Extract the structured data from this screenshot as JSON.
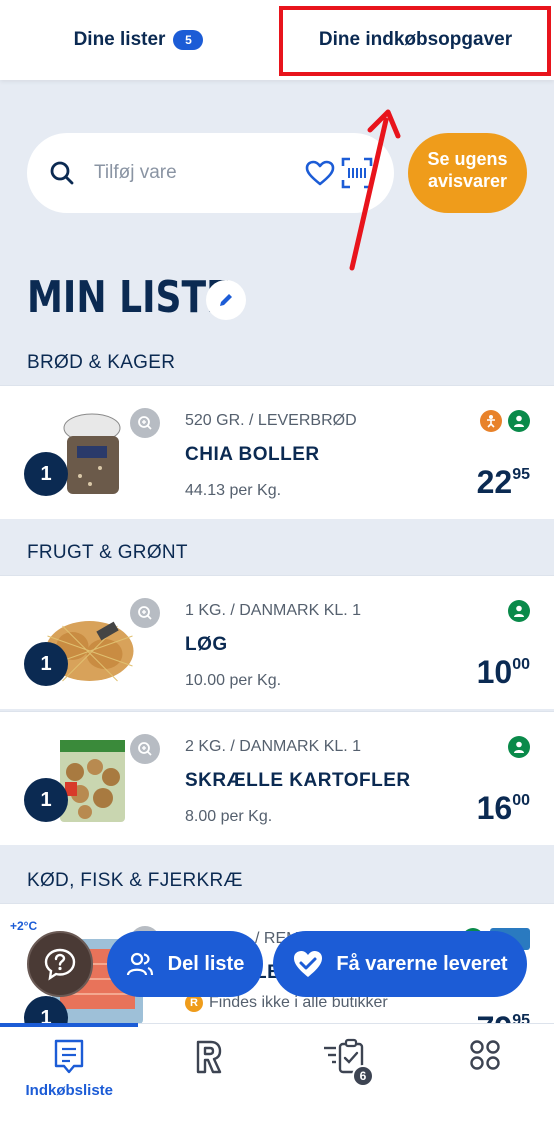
{
  "tabs": {
    "lists_label": "Dine lister",
    "lists_count": "5",
    "tasks_label": "Dine indkøbsopgaver"
  },
  "search": {
    "placeholder": "Tilføj vare"
  },
  "weekly_offers": {
    "line1": "Se ugens",
    "line2": "avisvarer"
  },
  "page_title": "MIN LISTE",
  "categories": [
    {
      "name": "BRØD & KAGER",
      "items": [
        {
          "qty": "1",
          "subtitle": "520 GR. / LEVERBRØD",
          "name": "CHIA BOLLER",
          "unit_price": "44.13 per Kg.",
          "price_main": "22",
          "price_cents": "95",
          "badges": [
            "kid-icon",
            "person-icon"
          ]
        }
      ]
    },
    {
      "name": "FRUGT & GRØNT",
      "items": [
        {
          "qty": "1",
          "subtitle": "1 KG. / DANMARK KL. 1",
          "name": "LØG",
          "unit_price": "10.00 per Kg.",
          "price_main": "10",
          "price_cents": "00",
          "badges": [
            "person-icon"
          ]
        },
        {
          "qty": "1",
          "subtitle": "2 KG. / DANMARK KL. 1",
          "name": "SKRÆLLE KARTOFLER",
          "unit_price": "8.00 per Kg.",
          "price_main": "16",
          "price_cents": "00",
          "badges": [
            "person-icon"
          ]
        }
      ]
    },
    {
      "name": "KØD, FISK & FJERKRÆ",
      "items": [
        {
          "qty": "1",
          "temp": "+2°C",
          "subtitle": "/ REM",
          "name": "LE",
          "note": "Findes ikke i alle butikker",
          "price_main": "79",
          "price_cents": "95"
        }
      ]
    }
  ],
  "floating": {
    "share_label": "Del liste",
    "deliver_label": "Få varerne leveret"
  },
  "bottom_nav": {
    "shopping_list_label": "Indkøbsliste",
    "tasks_count": "6"
  },
  "colors": {
    "primary_blue": "#1c5cd6",
    "navy": "#0b2a52",
    "orange": "#ef9c1b",
    "highlight_red": "#e8141c",
    "green": "#0a8a4a"
  }
}
